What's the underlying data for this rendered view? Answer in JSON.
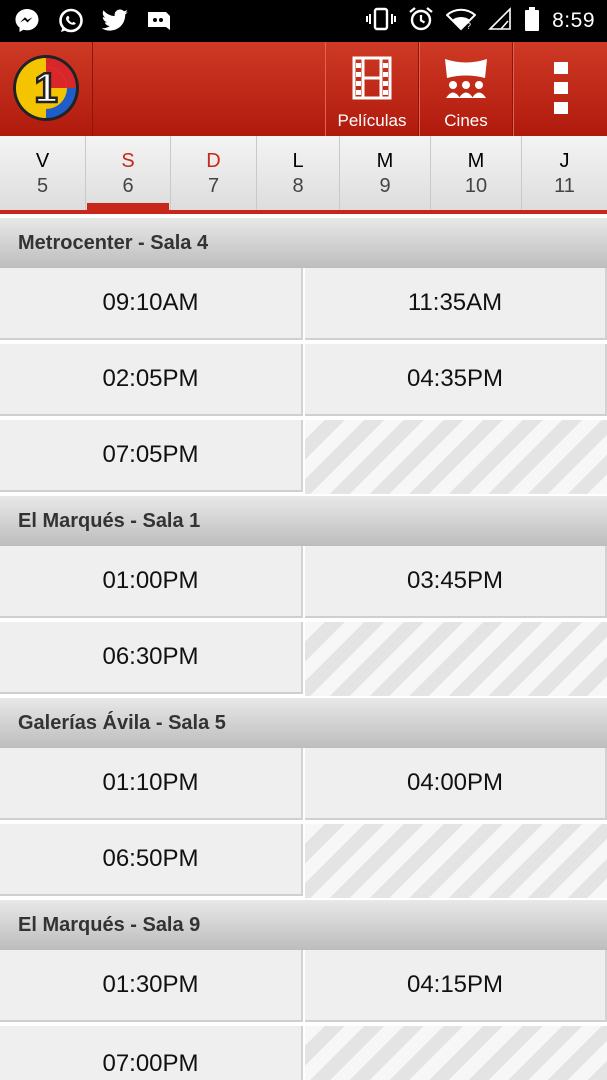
{
  "status_bar": {
    "time": "8:59",
    "left_icons": [
      "messenger-icon",
      "whatsapp-icon",
      "twitter-icon",
      "discord-icon"
    ],
    "right_icons": [
      "vibrate-icon",
      "alarm-icon",
      "wifi-icon",
      "signal-icon",
      "battery-icon"
    ]
  },
  "app_bar": {
    "logo_text": "1",
    "actions": [
      {
        "label": "Películas",
        "icon": "film-icon"
      },
      {
        "label": "Cines",
        "icon": "cinema-icon"
      },
      {
        "label": "",
        "icon": "overflow-menu-icon"
      }
    ]
  },
  "colors": {
    "accent": "#c8281a",
    "app_bar": "#c02a18",
    "selected_day_text": "#c8281a"
  },
  "days": [
    {
      "letter": "V",
      "number": "5",
      "selected": false,
      "weekend": false
    },
    {
      "letter": "S",
      "number": "6",
      "selected": true,
      "weekend": true
    },
    {
      "letter": "D",
      "number": "7",
      "selected": false,
      "weekend": true
    },
    {
      "letter": "L",
      "number": "8",
      "selected": false,
      "weekend": false
    },
    {
      "letter": "M",
      "number": "9",
      "selected": false,
      "weekend": false
    },
    {
      "letter": "M",
      "number": "10",
      "selected": false,
      "weekend": false
    },
    {
      "letter": "J",
      "number": "11",
      "selected": false,
      "weekend": false
    }
  ],
  "cinemas": [
    {
      "name": "Metrocenter - Sala 4",
      "times": [
        "09:10AM",
        "11:35AM",
        "02:05PM",
        "04:35PM",
        "07:05PM"
      ]
    },
    {
      "name": "El Marqués - Sala 1",
      "times": [
        "01:00PM",
        "03:45PM",
        "06:30PM"
      ]
    },
    {
      "name": "Galerías Ávila - Sala 5",
      "times": [
        "01:10PM",
        "04:00PM",
        "06:50PM"
      ]
    },
    {
      "name": "El Marqués - Sala 9",
      "times": [
        "01:30PM",
        "04:15PM",
        "07:00PM"
      ]
    }
  ]
}
